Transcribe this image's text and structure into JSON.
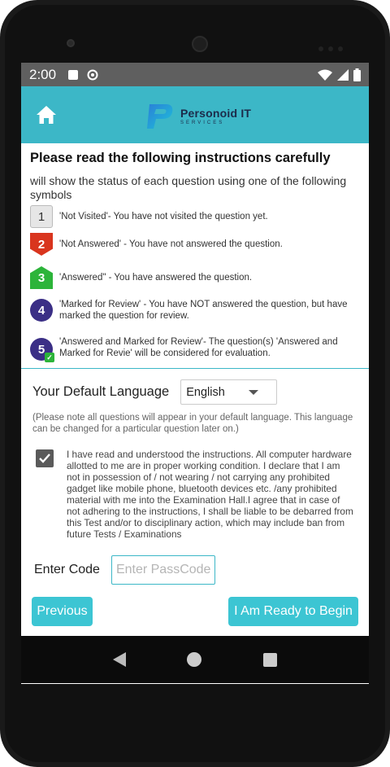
{
  "status_bar": {
    "time": "2:00"
  },
  "header": {
    "logo_title": "Personoid IT",
    "logo_subtitle": "SERVICES"
  },
  "instructions": {
    "title": "Please read the following instructions carefully",
    "intro": "will show the status of each question using one of the following symbols",
    "legend": [
      {
        "symbol": "1",
        "text": "'Not Visited'- You have not visited the question yet."
      },
      {
        "symbol": "2",
        "text": "'Not Answered' - You have not answered the question."
      },
      {
        "symbol": "3",
        "text": "'Answered\" - You have answered the question."
      },
      {
        "symbol": "4",
        "text": "'Marked for Review' - You have NOT answered the question, but have marked the question for review."
      },
      {
        "symbol": "5",
        "text": "'Answered and Marked for Review'- The question(s) 'Answered and Marked for Revie' will be considered for evaluation."
      }
    ]
  },
  "language": {
    "label": "Your Default Language",
    "selected": "English",
    "note": "(Please note all questions will appear in your default language. This language can be changed for a particular question later on.)"
  },
  "declaration": {
    "checked": true,
    "text": "I have read and understood the instructions. All computer hardware allotted to me are in proper working condition. I declare that I am not in possession of / not wearing / not carrying any prohibited gadget like mobile phone, bluetooth devices etc. /any prohibited material with me into the Examination Hall.I agree that in case of not adhering to the instructions, I shall be liable to be debarred from this Test and/or to disciplinary action, which may include ban from future Tests / Examinations"
  },
  "code": {
    "label": "Enter Code",
    "placeholder": "Enter PassCode"
  },
  "buttons": {
    "previous": "Previous",
    "begin": "I Am Ready to Begin"
  },
  "colors": {
    "accent": "#3cb7c7",
    "button": "#3cc5d3"
  },
  "icons": [
    "home-icon",
    "wifi-icon",
    "signal-icon",
    "battery-icon",
    "back-icon",
    "home-nav-icon",
    "recents-icon"
  ]
}
